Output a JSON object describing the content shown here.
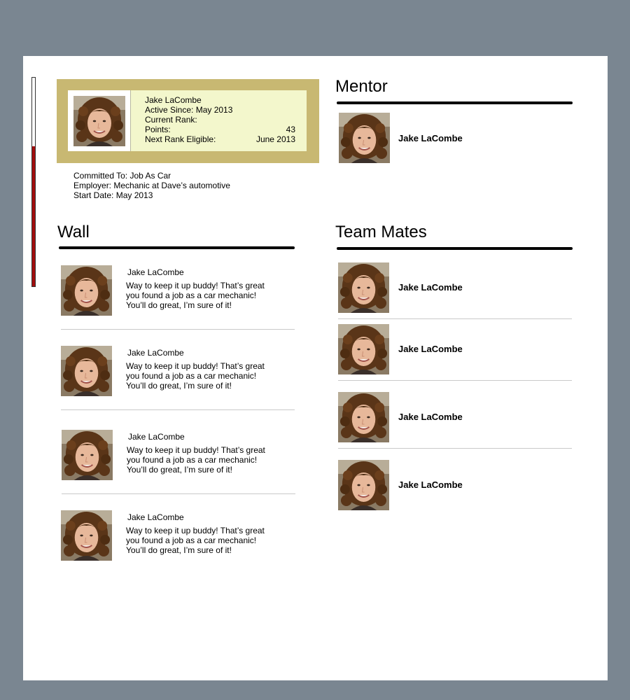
{
  "profile": {
    "name": "Jake LaCombe",
    "active_since": "Active Since: May 2013",
    "current_rank": "Current Rank:",
    "points_label": "Points:",
    "points_value": "43",
    "next_rank_label": "Next Rank Eligible:",
    "next_rank_value": "June 2013",
    "progress_fraction": 0.67
  },
  "commitment": {
    "committed_to": "Committed To: Job As Car",
    "employer": "Employer: Mechanic at Dave’s automotive",
    "start_date": "Start Date: May 2013"
  },
  "mentor": {
    "title": "Mentor",
    "name": "Jake LaCombe"
  },
  "wall": {
    "title": "Wall",
    "posts": [
      {
        "author": "Jake LaCombe",
        "message": "Way to keep it up buddy! That’s great you found a job as a car mechanic! You’ll do great, I’m sure of it!"
      },
      {
        "author": "Jake LaCombe",
        "message": "Way to keep it up buddy! That’s great you found a job as a car mechanic! You’ll do great, I’m sure of it!"
      },
      {
        "author": "Jake LaCombe",
        "message": "Way to keep it up buddy! That’s great you found a job as a car mechanic! You’ll do great, I’m sure of it!"
      },
      {
        "author": "Jake LaCombe",
        "message": "Way to keep it up buddy! That’s great you found a job as a car mechanic! You’ll do great, I’m sure of it!"
      }
    ]
  },
  "team": {
    "title": "Team Mates",
    "members": [
      {
        "name": "Jake LaCombe"
      },
      {
        "name": "Jake LaCombe"
      },
      {
        "name": "Jake LaCombe"
      },
      {
        "name": "Jake LaCombe"
      }
    ]
  },
  "colors": {
    "background": "#7a8691",
    "card_gold": "#c8b872",
    "card_inner": "#f3f7cc",
    "progress_red": "#a10d0d"
  },
  "icons": {
    "avatar": "user-photo-icon"
  }
}
